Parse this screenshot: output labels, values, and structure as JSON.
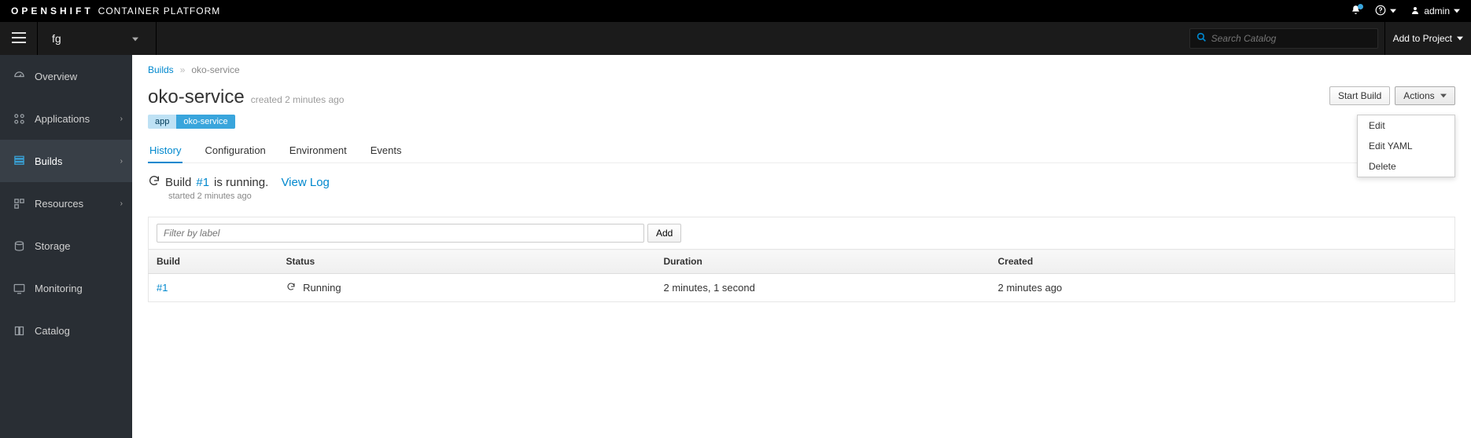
{
  "masthead": {
    "brand": "OPENSHIFT",
    "brand_sub": "CONTAINER PLATFORM",
    "help_label": "Help",
    "user": "admin"
  },
  "contextbar": {
    "project": "fg",
    "search_placeholder": "Search Catalog",
    "add_to_project": "Add to Project"
  },
  "sidebar": {
    "items": [
      {
        "label": "Overview"
      },
      {
        "label": "Applications"
      },
      {
        "label": "Builds"
      },
      {
        "label": "Resources"
      },
      {
        "label": "Storage"
      },
      {
        "label": "Monitoring"
      },
      {
        "label": "Catalog"
      }
    ]
  },
  "breadcrumb": {
    "root": "Builds",
    "sep": "»",
    "current": "oko-service"
  },
  "page": {
    "title": "oko-service",
    "created_meta": "created 2 minutes ago",
    "start_build": "Start Build",
    "actions": "Actions",
    "actions_menu": {
      "edit": "Edit",
      "edit_yaml": "Edit YAML",
      "delete": "Delete"
    },
    "label_key": "app",
    "label_val": "oko-service"
  },
  "tabs": {
    "history": "History",
    "configuration": "Configuration",
    "environment": "Environment",
    "events": "Events"
  },
  "status": {
    "prefix": "Build ",
    "link": "#1",
    "suffix": " is running.",
    "view_log": "View Log",
    "started": "started 2 minutes ago"
  },
  "filter": {
    "placeholder": "Filter by label",
    "add": "Add"
  },
  "table": {
    "cols": {
      "build": "Build",
      "status": "Status",
      "duration": "Duration",
      "created": "Created"
    },
    "rows": [
      {
        "build": "#1",
        "status": "Running",
        "duration": "2 minutes, 1 second",
        "created": "2 minutes ago"
      }
    ]
  }
}
